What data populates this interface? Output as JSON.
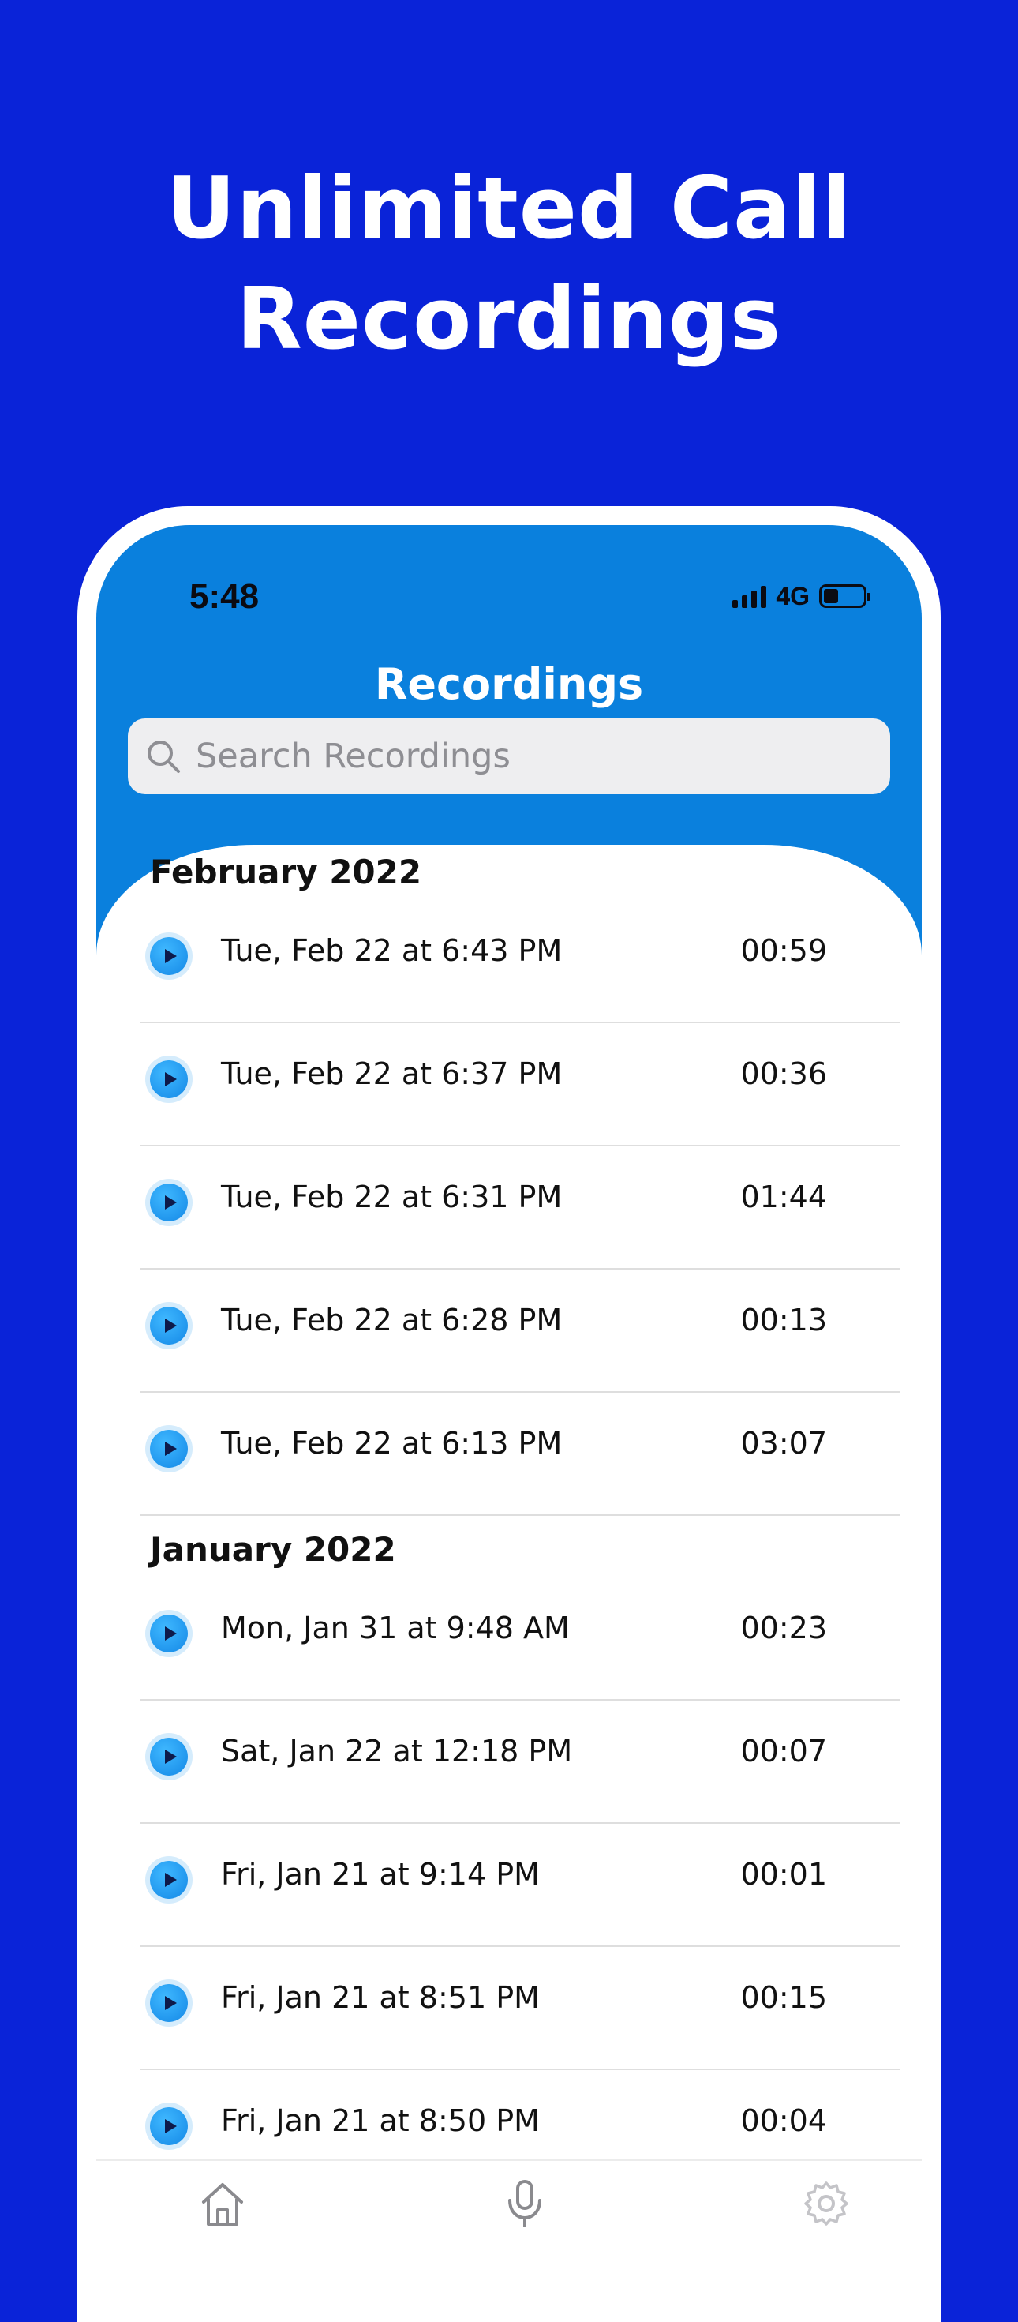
{
  "headline": {
    "line1": "Unlimited Call",
    "line2": "Recordings"
  },
  "status_bar": {
    "time": "5:48",
    "network": "4G"
  },
  "screen": {
    "title": "Recordings",
    "search_placeholder": "Search Recordings"
  },
  "sections": [
    {
      "title": "February 2022",
      "items": [
        {
          "date": "Tue, Feb 22 at 6:43 PM",
          "duration": "00:59"
        },
        {
          "date": "Tue, Feb 22 at 6:37 PM",
          "duration": "00:36"
        },
        {
          "date": "Tue, Feb 22 at 6:31 PM",
          "duration": "01:44"
        },
        {
          "date": "Tue, Feb 22 at 6:28 PM",
          "duration": "00:13"
        },
        {
          "date": "Tue, Feb 22 at 6:13 PM",
          "duration": "03:07"
        }
      ]
    },
    {
      "title": "January 2022",
      "items": [
        {
          "date": "Mon, Jan 31 at 9:48 AM",
          "duration": "00:23"
        },
        {
          "date": "Sat, Jan 22 at 12:18 PM",
          "duration": "00:07"
        },
        {
          "date": "Fri, Jan 21 at 9:14 PM",
          "duration": "00:01"
        },
        {
          "date": "Fri, Jan 21 at 8:51 PM",
          "duration": "00:15"
        },
        {
          "date": "Fri, Jan 21 at 8:50 PM",
          "duration": "00:04"
        }
      ]
    }
  ],
  "tabs": [
    {
      "icon": "home-icon"
    },
    {
      "icon": "microphone-icon"
    },
    {
      "icon": "gear-icon"
    }
  ],
  "colors": {
    "background": "#0a23d8",
    "header": "#0a80dd",
    "play_button": "#1488e6"
  }
}
